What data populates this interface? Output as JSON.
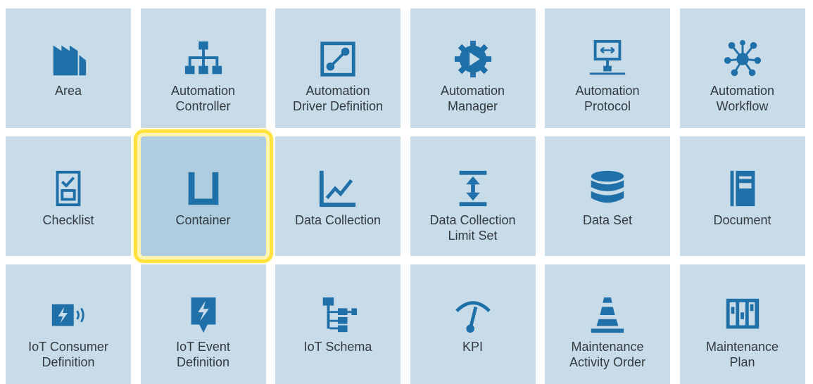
{
  "colors": {
    "tile_bg": "#c8dbe8",
    "selected_bg": "#aecde0",
    "highlight": "#ffe23c",
    "icon": "#1f6fa8"
  },
  "tiles": [
    {
      "label": "Area",
      "icon": "factory-icon"
    },
    {
      "label": "Automation\nController",
      "icon": "hierarchy-icon"
    },
    {
      "label": "Automation\nDriver Definition",
      "icon": "driver-icon"
    },
    {
      "label": "Automation\nManager",
      "icon": "gear-play-icon"
    },
    {
      "label": "Automation\nProtocol",
      "icon": "protocol-icon"
    },
    {
      "label": "Automation\nWorkflow",
      "icon": "workflow-icon"
    },
    {
      "label": "Checklist",
      "icon": "checklist-icon"
    },
    {
      "label": "Container",
      "icon": "container-icon",
      "selected": true
    },
    {
      "label": "Data Collection",
      "icon": "line-chart-icon"
    },
    {
      "label": "Data Collection\nLimit Set",
      "icon": "limit-set-icon"
    },
    {
      "label": "Data Set",
      "icon": "database-icon"
    },
    {
      "label": "Document",
      "icon": "document-icon"
    },
    {
      "label": "IoT Consumer\nDefinition",
      "icon": "iot-consumer-icon"
    },
    {
      "label": "IoT Event\nDefinition",
      "icon": "iot-event-icon"
    },
    {
      "label": "IoT Schema",
      "icon": "schema-icon"
    },
    {
      "label": "KPI",
      "icon": "gauge-icon"
    },
    {
      "label": "Maintenance\nActivity Order",
      "icon": "cone-icon"
    },
    {
      "label": "Maintenance\nPlan",
      "icon": "plan-icon"
    }
  ]
}
